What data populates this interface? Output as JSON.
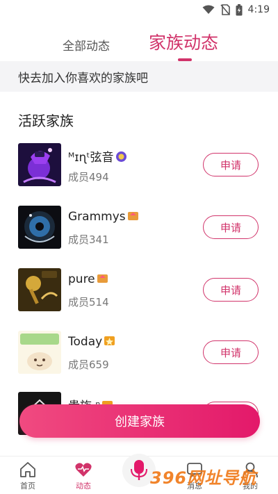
{
  "status_bar": {
    "time": "4:19"
  },
  "tabs": {
    "all_label": "全部动态",
    "family_label": "家族动态",
    "active": "family"
  },
  "banner": {
    "text": "快去加入你喜欢的家族吧"
  },
  "section": {
    "title": "活跃家族"
  },
  "families": [
    {
      "name": "ᴹɪɳᵗ弦音",
      "members": "成员494",
      "apply_label": "申请",
      "avatar_icon": "music-cover-icon",
      "badge_color": "#6b4bd6"
    },
    {
      "name": "Grammys",
      "members": "成员341",
      "apply_label": "申请",
      "avatar_icon": "record-cover-icon",
      "badge_color": "#e89b3a"
    },
    {
      "name": "pure",
      "members": "成员514",
      "apply_label": "申请",
      "avatar_icon": "microphone-cover-icon",
      "badge_color": "#e89b3a"
    },
    {
      "name": "Today",
      "members": "成员659",
      "apply_label": "申请",
      "avatar_icon": "cartoon-cover-icon",
      "badge_color": "#f0a020"
    },
    {
      "name": "贵族 ⁿ",
      "members": "",
      "apply_label": "申请",
      "avatar_icon": "dark-cover-icon",
      "badge_color": "#f0a020"
    }
  ],
  "create_button": {
    "label": "创建家族"
  },
  "bottom_nav": {
    "home": "首页",
    "moments": "动态",
    "messages": "消息",
    "me": "我的",
    "active": "moments"
  },
  "watermark": {
    "text": "396网址导航"
  },
  "colors": {
    "accent": "#d1336a",
    "button_gradient_start": "#f04a80",
    "button_gradient_end": "#e3196a"
  }
}
